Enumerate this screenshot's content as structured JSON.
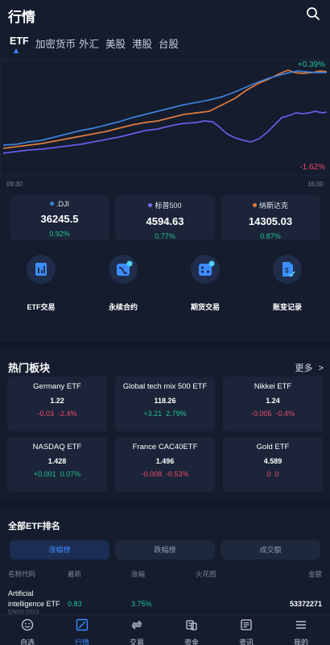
{
  "header": {
    "title": "行情"
  },
  "tabs": [
    "ETF",
    "加密货币",
    "外汇",
    "美股",
    "港股",
    "台股"
  ],
  "chart": {
    "pct_top": "+0.39%",
    "pct_bottom": "-1.62%",
    "time_start": "09:30",
    "time_end": "16:00",
    "series_colors": {
      "dji": "#3f7fd6",
      "spx": "#6b5ce7",
      "nasdaq": "#e07a3a"
    }
  },
  "indices": [
    {
      "name": ".DJI",
      "value": "36245.5",
      "pct": "0.92%",
      "dot": "#3f7fd6"
    },
    {
      "name": "标普500",
      "value": "4594.63",
      "pct": "0.77%",
      "dot": "#7a6cf0"
    },
    {
      "name": "纳斯达克",
      "value": "14305.03",
      "pct": "0.87%",
      "dot": "#e07a3a"
    }
  ],
  "shortcuts": [
    {
      "label": "ETF交易",
      "icon": "bar-chart-icon"
    },
    {
      "label": "永续合约",
      "icon": "contract-icon"
    },
    {
      "label": "期货交易",
      "icon": "futures-icon"
    },
    {
      "label": "账变记录",
      "icon": "record-icon"
    }
  ],
  "hot": {
    "title": "热门板块",
    "more": "更多",
    "items": [
      {
        "name": "Germany ETF",
        "value": "1.22",
        "change": "-0.03",
        "pct": "-2.4%",
        "dir": "down"
      },
      {
        "name": "Global tech mix 500 ETF",
        "value": "118.26",
        "change": "+3.21",
        "pct": "2.79%",
        "dir": "up"
      },
      {
        "name": "Nikkei ETF",
        "value": "1.24",
        "change": "-0.005",
        "pct": "-0.4%",
        "dir": "down"
      },
      {
        "name": "NASDAQ ETF",
        "value": "1.428",
        "change": "+0.001",
        "pct": "0.07%",
        "dir": "up"
      },
      {
        "name": "France CAC40ETF",
        "value": "1.496",
        "change": "-0.008",
        "pct": "-0.53%",
        "dir": "down"
      },
      {
        "name": "Gold ETF",
        "value": "4.589",
        "change": "0",
        "pct": "0",
        "dir": "down"
      }
    ]
  },
  "ranking": {
    "title": "全部ETF排名",
    "segments": [
      "涨幅榜",
      "跌幅榜",
      "成交额"
    ],
    "columns": [
      "名称代码",
      "最新",
      "涨幅",
      "火花图",
      "金额"
    ],
    "rows": [
      {
        "name": "Artificial intelligence ETF",
        "code": "QNDX-2023",
        "last": "0.83",
        "pct": "3.75%",
        "amount": "53372271"
      }
    ]
  },
  "bottom_nav": [
    {
      "label": "自选",
      "icon": "smile-icon"
    },
    {
      "label": "行情",
      "icon": "chart-icon"
    },
    {
      "label": "交易",
      "icon": "trade-icon"
    },
    {
      "label": "资金",
      "icon": "wallet-icon"
    },
    {
      "label": "资讯",
      "icon": "news-icon"
    },
    {
      "label": "我的",
      "icon": "menu-icon"
    }
  ],
  "colors": {
    "accent": "#3c8cff",
    "up": "#1fc592",
    "down": "#f04a6d",
    "bg": "#141c2e",
    "card": "#1b2438"
  }
}
